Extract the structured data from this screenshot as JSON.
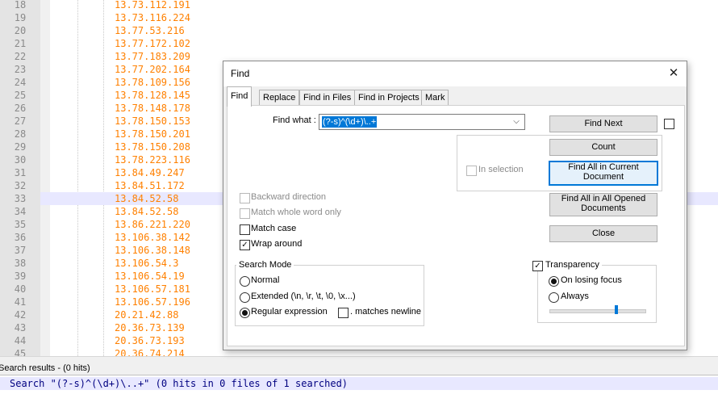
{
  "editor": {
    "current_line": 33,
    "lines": [
      {
        "num": "18",
        "text": "13.73.112.191"
      },
      {
        "num": "19",
        "text": "13.73.116.224"
      },
      {
        "num": "20",
        "text": "13.77.53.216"
      },
      {
        "num": "21",
        "text": "13.77.172.102"
      },
      {
        "num": "22",
        "text": "13.77.183.209"
      },
      {
        "num": "23",
        "text": "13.77.202.164"
      },
      {
        "num": "24",
        "text": "13.78.109.156"
      },
      {
        "num": "25",
        "text": "13.78.128.145"
      },
      {
        "num": "26",
        "text": "13.78.148.178"
      },
      {
        "num": "27",
        "text": "13.78.150.153"
      },
      {
        "num": "28",
        "text": "13.78.150.201"
      },
      {
        "num": "29",
        "text": "13.78.150.208"
      },
      {
        "num": "30",
        "text": "13.78.223.116"
      },
      {
        "num": "31",
        "text": "13.84.49.247"
      },
      {
        "num": "32",
        "text": "13.84.51.172"
      },
      {
        "num": "33",
        "text": "13.84.52.58"
      },
      {
        "num": "34",
        "text": "13.84.52.58"
      },
      {
        "num": "35",
        "text": "13.86.221.220"
      },
      {
        "num": "36",
        "text": "13.106.38.142"
      },
      {
        "num": "37",
        "text": "13.106.38.148"
      },
      {
        "num": "38",
        "text": "13.106.54.3"
      },
      {
        "num": "39",
        "text": "13.106.54.19"
      },
      {
        "num": "40",
        "text": "13.106.57.181"
      },
      {
        "num": "41",
        "text": "13.106.57.196"
      },
      {
        "num": "42",
        "text": "20.21.42.88"
      },
      {
        "num": "43",
        "text": "20.36.73.139"
      },
      {
        "num": "44",
        "text": "20.36.73.193"
      },
      {
        "num": "45",
        "text": "20.36.74.214"
      }
    ]
  },
  "search_results": {
    "header": "Search results - (0 hits)",
    "line": "Search \"(?-s)^(\\d+)\\..+\" (0 hits in 0 files of 1 searched)"
  },
  "dialog": {
    "title": "Find",
    "close_glyph": "✕",
    "tabs": [
      "Find",
      "Replace",
      "Find in Files",
      "Find in Projects",
      "Mark"
    ],
    "find_what_label": "Find what :",
    "find_what_value": "(?-s)^(\\d+)\\..+",
    "dropdown_glyph": "⌵",
    "buttons": {
      "find_next": "Find Next",
      "count": "Count",
      "find_all_current_1": "Find All in Current",
      "find_all_current_2": "Document",
      "find_all_opened_1": "Find All in All Opened",
      "find_all_opened_2": "Documents",
      "close": "Close"
    },
    "in_selection": "In selection",
    "options": {
      "backward": "Backward direction",
      "whole_word": "Match whole word only",
      "match_case": "Match case",
      "wrap_around": "Wrap around"
    },
    "check_glyph": "✓",
    "search_mode": {
      "title": "Search Mode",
      "normal": "Normal",
      "extended": "Extended (\\n, \\r, \\t, \\0, \\x...)",
      "regex": "Regular expression",
      "matches_newline": ". matches newline"
    },
    "transparency": {
      "label": "Transparency",
      "on_losing_focus": "On losing focus",
      "always": "Always",
      "slider_level": 0.7
    }
  }
}
